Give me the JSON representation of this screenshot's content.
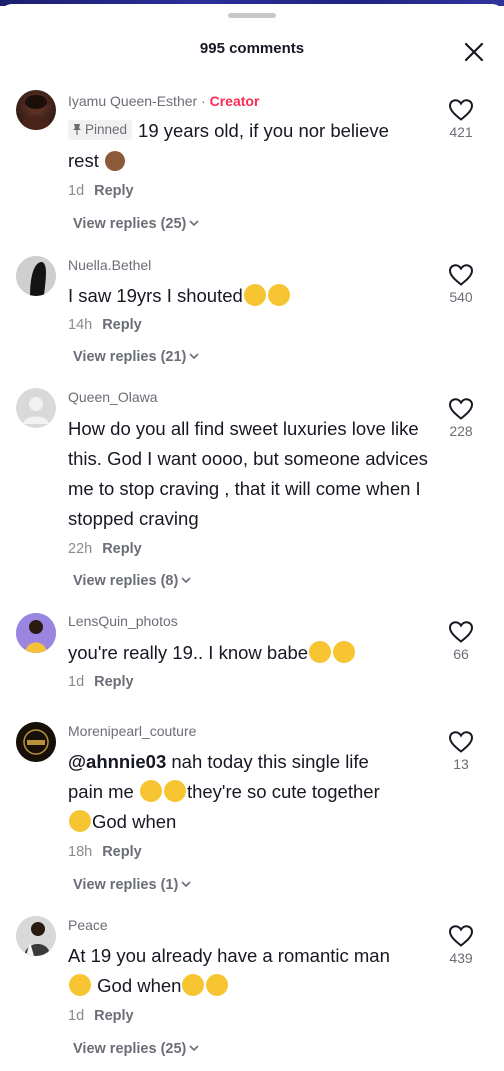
{
  "header": {
    "title": "995 comments"
  },
  "comments": [
    {
      "username": "Iyamu Queen-Esther",
      "creator_label": "Creator",
      "pinned_label": "Pinned",
      "text1": "19 years old, if you nor believe",
      "text2": "rest",
      "time": "1d",
      "reply": "Reply",
      "likes": "421",
      "view_replies": "View replies (25)"
    },
    {
      "username": "Nuella.Bethel",
      "text1": "I saw 19yrs I shouted",
      "time": "14h",
      "reply": "Reply",
      "likes": "540",
      "view_replies": "View replies (21)"
    },
    {
      "username": "Queen_Olawa",
      "text": "How do you all find sweet luxuries love like this. God I want oooo, but someone advices me to stop craving , that it will come when I stopped craving",
      "time": "22h",
      "reply": "Reply",
      "likes": "228",
      "view_replies": "View replies (8)"
    },
    {
      "username": "LensQuin_photos",
      "text1": "you're really 19.. I know babe",
      "time": "1d",
      "reply": "Reply",
      "likes": "66"
    },
    {
      "username": "Morenipearl_couture",
      "mention": "@ahnnie03",
      "text1": " nah today this single life",
      "text2": "pain me ",
      "text3": "they're so cute together",
      "text4": "God when",
      "time": "18h",
      "reply": "Reply",
      "likes": "13",
      "view_replies": "View replies (1)"
    },
    {
      "username": "Peace",
      "text1": "At 19 you already have a romantic man",
      "text2": " God when",
      "time": "1d",
      "reply": "Reply",
      "likes": "439",
      "view_replies": "View replies (25)"
    }
  ],
  "colors": {
    "accent": "#fe2c55",
    "primary_text": "#161823",
    "secondary_text": "#6b6e76"
  },
  "icons": [
    "close-icon",
    "heart-outline-icon",
    "pin-icon",
    "chevron-down-icon"
  ]
}
